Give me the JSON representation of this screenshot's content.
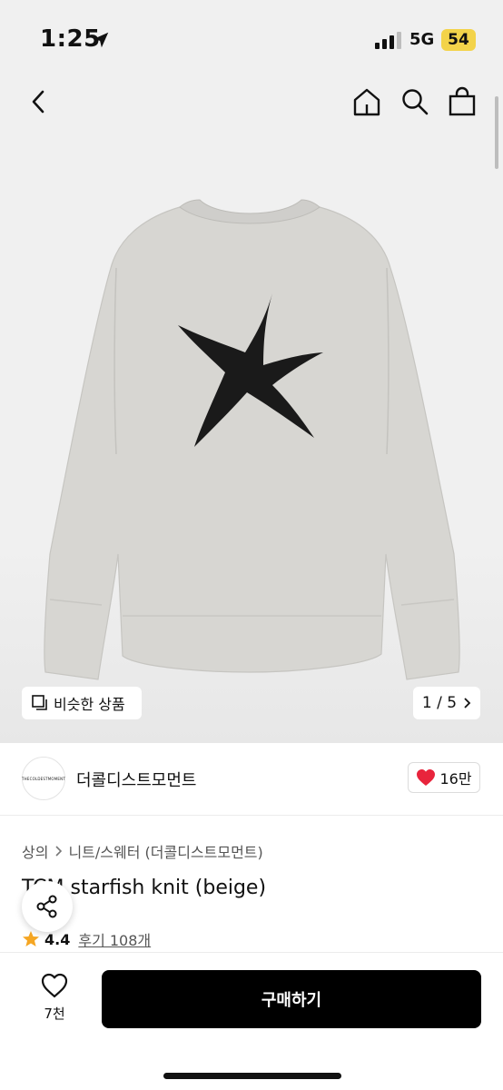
{
  "status_bar": {
    "time": "1:25",
    "network": "5G",
    "battery": "54"
  },
  "gallery": {
    "similar_label": "비슷한 상품",
    "pager": "1 / 5"
  },
  "brand": {
    "logo_text": "THECOLDESTMOMENT",
    "name": "더콜디스트모먼트",
    "likes": "16만"
  },
  "breadcrumb": {
    "level1": "상의",
    "level2": "니트/스웨터 (더콜디스트모먼트)"
  },
  "product": {
    "title": "TCM starfish knit (beige)",
    "rating": "4.4",
    "reviews": "후기 108개"
  },
  "bottom": {
    "wish_count": "7천",
    "buy_label": "구매하기"
  },
  "colors": {
    "heart": "#e8243c",
    "star": "#f5a623",
    "sweater": "#d7d6d2",
    "starfish": "#1a1a1a"
  }
}
